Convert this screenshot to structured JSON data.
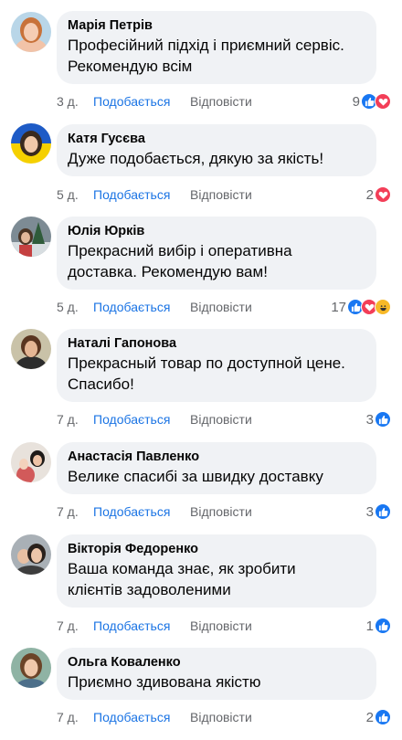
{
  "colors": {
    "like": "#1877f2",
    "love": "#f33e58",
    "haha": "#f7b928",
    "bubble": "#f0f2f5",
    "meta": "#65676b",
    "action_link": "#1b74e4"
  },
  "comments": [
    {
      "name": "Марія Петрів",
      "lines": [
        "Професійний підхід і приємний сервіс.",
        "Рекомендую всім"
      ],
      "time": "3 д.",
      "like": "Подобається",
      "reply": "Відповісти",
      "count": "9",
      "reactions": [
        "like-icon",
        "love-icon"
      ]
    },
    {
      "name": "Катя Гусєва",
      "lines": [
        "Дуже подобається, дякую за якість!"
      ],
      "time": "5 д.",
      "like": "Подобається",
      "reply": "Відповісти",
      "count": "2",
      "reactions": [
        "love-icon"
      ]
    },
    {
      "name": "Юлія Юрків",
      "lines": [
        "Прекрасний вибір і оперативна",
        "доставка. Рекомендую вам!"
      ],
      "time": "5 д.",
      "like": "Подобається",
      "reply": "Відповісти",
      "count": "17",
      "reactions": [
        "like-icon",
        "love-icon",
        "haha-icon"
      ]
    },
    {
      "name": "Наталі Гапонова",
      "lines": [
        "Прекрасный товар по доступной цене.",
        "Спасибо!"
      ],
      "time": "7 д.",
      "like": "Подобається",
      "reply": "Відповісти",
      "count": "3",
      "reactions": [
        "like-icon"
      ]
    },
    {
      "name": "Анастасія Павленко",
      "lines": [
        "Велике спасибі за швидку доставку"
      ],
      "time": "7 д.",
      "like": "Подобається",
      "reply": "Відповісти",
      "count": "3",
      "reactions": [
        "like-icon"
      ]
    },
    {
      "name": "Вікторія Федоренко",
      "lines": [
        "Ваша команда знає, як зробити",
        "клієнтів задоволеними"
      ],
      "time": "7 д.",
      "like": "Подобається",
      "reply": "Відповісти",
      "count": "1",
      "reactions": [
        "like-icon"
      ]
    },
    {
      "name": "Ольга Коваленко",
      "lines": [
        "Приємно здивована якістю"
      ],
      "time": "7 д.",
      "like": "Подобається",
      "reply": "Відповісти",
      "count": "2",
      "reactions": [
        "like-icon"
      ]
    }
  ]
}
